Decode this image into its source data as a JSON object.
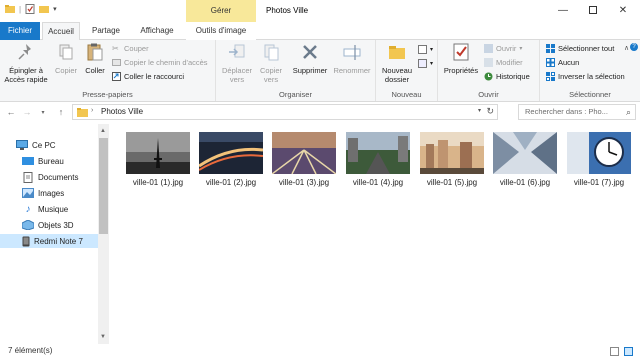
{
  "window": {
    "title": "Photos Ville",
    "context_group": "Gérer",
    "minimize_icon": "minimize-icon",
    "maximize_icon": "maximize-icon",
    "close_icon": "close-icon"
  },
  "tabs": [
    {
      "label": "Fichier"
    },
    {
      "label": "Accueil"
    },
    {
      "label": "Partage"
    },
    {
      "label": "Affichage"
    },
    {
      "label": "Outils d'image"
    }
  ],
  "ribbon": {
    "clipboard": {
      "pin": "Épingler à\nAccès rapide",
      "copy": "Copier",
      "paste": "Coller",
      "cut": "Couper",
      "copy_path": "Copier le chemin d'accès",
      "paste_shortcut": "Coller le raccourci",
      "label": "Presse-papiers"
    },
    "organize": {
      "move": "Déplacer\nvers",
      "copyto": "Copier\nvers",
      "delete": "Supprimer",
      "rename": "Renommer",
      "label": "Organiser"
    },
    "new": {
      "new_folder": "Nouveau\ndossier",
      "label": "Nouveau"
    },
    "open": {
      "properties": "Propriétés",
      "open": "Ouvrir",
      "modify": "Modifier",
      "history": "Historique",
      "label": "Ouvrir"
    },
    "select": {
      "select_all": "Sélectionner tout",
      "none": "Aucun",
      "invert": "Inverser la sélection",
      "label": "Sélectionner"
    }
  },
  "address": {
    "path": "Photos Ville",
    "search_placeholder": "Rechercher dans : Pho..."
  },
  "nav": [
    {
      "label": "Ce PC",
      "icon": "computer-icon"
    },
    {
      "label": "Bureau",
      "icon": "desktop-folder-icon"
    },
    {
      "label": "Documents",
      "icon": "documents-folder-icon"
    },
    {
      "label": "Images",
      "icon": "pictures-folder-icon"
    },
    {
      "label": "Musique",
      "icon": "music-folder-icon"
    },
    {
      "label": "Objets 3D",
      "icon": "3d-objects-folder-icon"
    },
    {
      "label": "Redmi Note 7",
      "icon": "phone-icon"
    }
  ],
  "files": [
    {
      "name": "ville-01 (1).jpg"
    },
    {
      "name": "ville-01 (2).jpg"
    },
    {
      "name": "ville-01 (3).jpg"
    },
    {
      "name": "ville-01 (4).jpg"
    },
    {
      "name": "ville-01 (5).jpg"
    },
    {
      "name": "ville-01 (6).jpg"
    },
    {
      "name": "ville-01 (7).jpg"
    }
  ],
  "status": {
    "count": "7 élément(s)"
  },
  "colors": {
    "accent": "#1979ca",
    "context_tab": "#f8e89a",
    "selection": "#cce8ff"
  }
}
